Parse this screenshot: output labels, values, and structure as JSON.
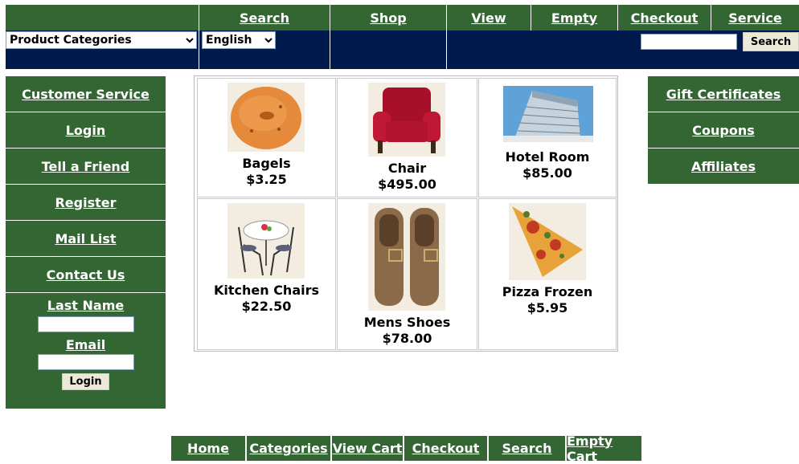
{
  "top_nav": [
    "Search",
    "Shop",
    "View",
    "Empty",
    "Checkout",
    "Service"
  ],
  "toolbar": {
    "category_select": "Product Categories",
    "language_select": "English",
    "search_value": "",
    "search_button": "Search"
  },
  "left_menu": [
    "Customer Service",
    "Login",
    "Tell a Friend",
    "Register",
    "Mail List",
    "Contact Us"
  ],
  "login_form": {
    "last_name_label": "Last Name",
    "email_label": "Email",
    "last_name_value": "",
    "email_value": "",
    "login_button": "Login"
  },
  "right_menu": [
    "Gift Certificates",
    "Coupons",
    "Affiliates"
  ],
  "products": [
    {
      "name": "Bagels",
      "price": "$3.25",
      "icon": "bagel-image"
    },
    {
      "name": "Chair",
      "price": "$495.00",
      "icon": "red-armchair-image"
    },
    {
      "name": "Hotel Room",
      "price": "$85.00",
      "icon": "hotel-building-image"
    },
    {
      "name": "Kitchen Chairs",
      "price": "$22.50",
      "icon": "kitchen-table-chairs-image"
    },
    {
      "name": "Mens Shoes",
      "price": "$78.00",
      "icon": "brown-shoes-image"
    },
    {
      "name": "Pizza Frozen",
      "price": "$5.95",
      "icon": "pizza-slice-image"
    }
  ],
  "bottom_nav": [
    "Home",
    "Categories",
    "View Cart",
    "Checkout",
    "Search",
    "Empty Cart"
  ],
  "colors": {
    "nav_green": "#336633",
    "toolbar_navy": "#001a4d",
    "link_text": "#ffffff"
  }
}
